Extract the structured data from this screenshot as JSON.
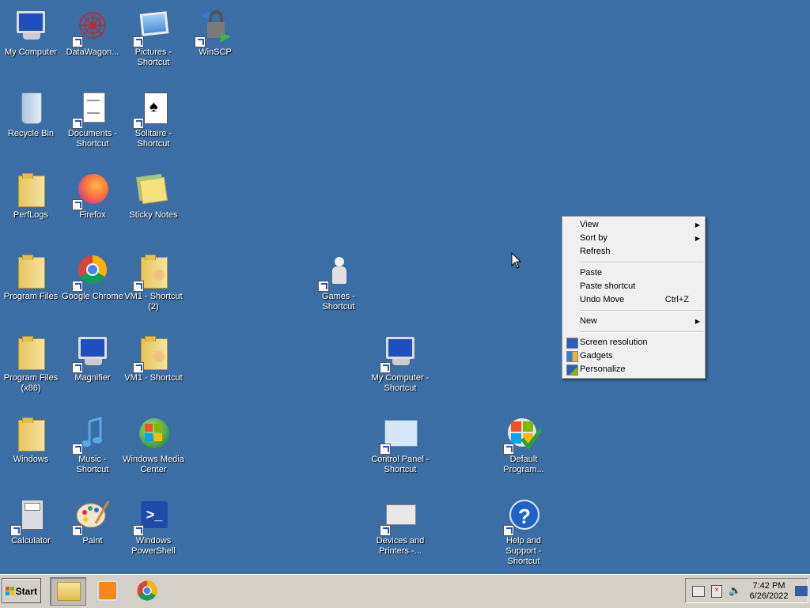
{
  "desktop": {
    "icons": [
      {
        "label": "My Computer",
        "icon": "computer-icon"
      },
      {
        "label": "DataWagon...",
        "icon": "datawagon-icon"
      },
      {
        "label": "Pictures - Shortcut",
        "icon": "pictures-icon"
      },
      {
        "label": "WinSCP",
        "icon": "winscp-icon"
      },
      {
        "label": "Recycle Bin",
        "icon": "recycle-bin-icon"
      },
      {
        "label": "Documents - Shortcut",
        "icon": "documents-icon"
      },
      {
        "label": "Solitaire - Shortcut",
        "icon": "solitaire-icon"
      },
      {
        "label": "PerfLogs",
        "icon": "folder-icon"
      },
      {
        "label": "Firefox",
        "icon": "firefox-icon"
      },
      {
        "label": "Sticky Notes",
        "icon": "sticky-notes-icon"
      },
      {
        "label": "Program Files",
        "icon": "folder-icon"
      },
      {
        "label": "Google Chrome",
        "icon": "chrome-icon"
      },
      {
        "label": "VM1 - Shortcut (2)",
        "icon": "folder-user-icon"
      },
      {
        "label": "Games - Shortcut",
        "icon": "games-icon"
      },
      {
        "label": "Program Files (x86)",
        "icon": "folder-icon"
      },
      {
        "label": "Magnifier",
        "icon": "magnifier-icon"
      },
      {
        "label": "VM1 - Shortcut",
        "icon": "folder-user-icon"
      },
      {
        "label": "My Computer - Shortcut",
        "icon": "computer-icon"
      },
      {
        "label": "Windows",
        "icon": "folder-icon"
      },
      {
        "label": "Music - Shortcut",
        "icon": "music-icon"
      },
      {
        "label": "Windows Media Center",
        "icon": "media-center-icon"
      },
      {
        "label": "Control Panel - Shortcut",
        "icon": "control-panel-icon"
      },
      {
        "label": "Default Program...",
        "icon": "default-programs-icon"
      },
      {
        "label": "Calculator",
        "icon": "calculator-icon"
      },
      {
        "label": "Paint",
        "icon": "paint-icon"
      },
      {
        "label": "Windows PowerShell",
        "icon": "powershell-icon"
      },
      {
        "label": "Devices and Printers -...",
        "icon": "printer-icon"
      },
      {
        "label": "Help and Support - Shortcut",
        "icon": "help-icon"
      }
    ]
  },
  "context_menu": {
    "view": "View",
    "sort_by": "Sort by",
    "refresh": "Refresh",
    "paste": "Paste",
    "paste_shortcut": "Paste shortcut",
    "undo_move": "Undo Move",
    "undo_move_shortcut": "Ctrl+Z",
    "new": "New",
    "screen_resolution": "Screen resolution",
    "gadgets": "Gadgets",
    "personalize": "Personalize"
  },
  "taskbar": {
    "start_label": "Start",
    "pinned": [
      "explorer-icon",
      "media-player-icon",
      "chrome-icon"
    ],
    "clock_time": "7:42 PM",
    "clock_date": "6/26/2022"
  },
  "colors": {
    "desktop_bg": "#3a6ea5",
    "taskbar_bg": "#d4d0c8"
  }
}
